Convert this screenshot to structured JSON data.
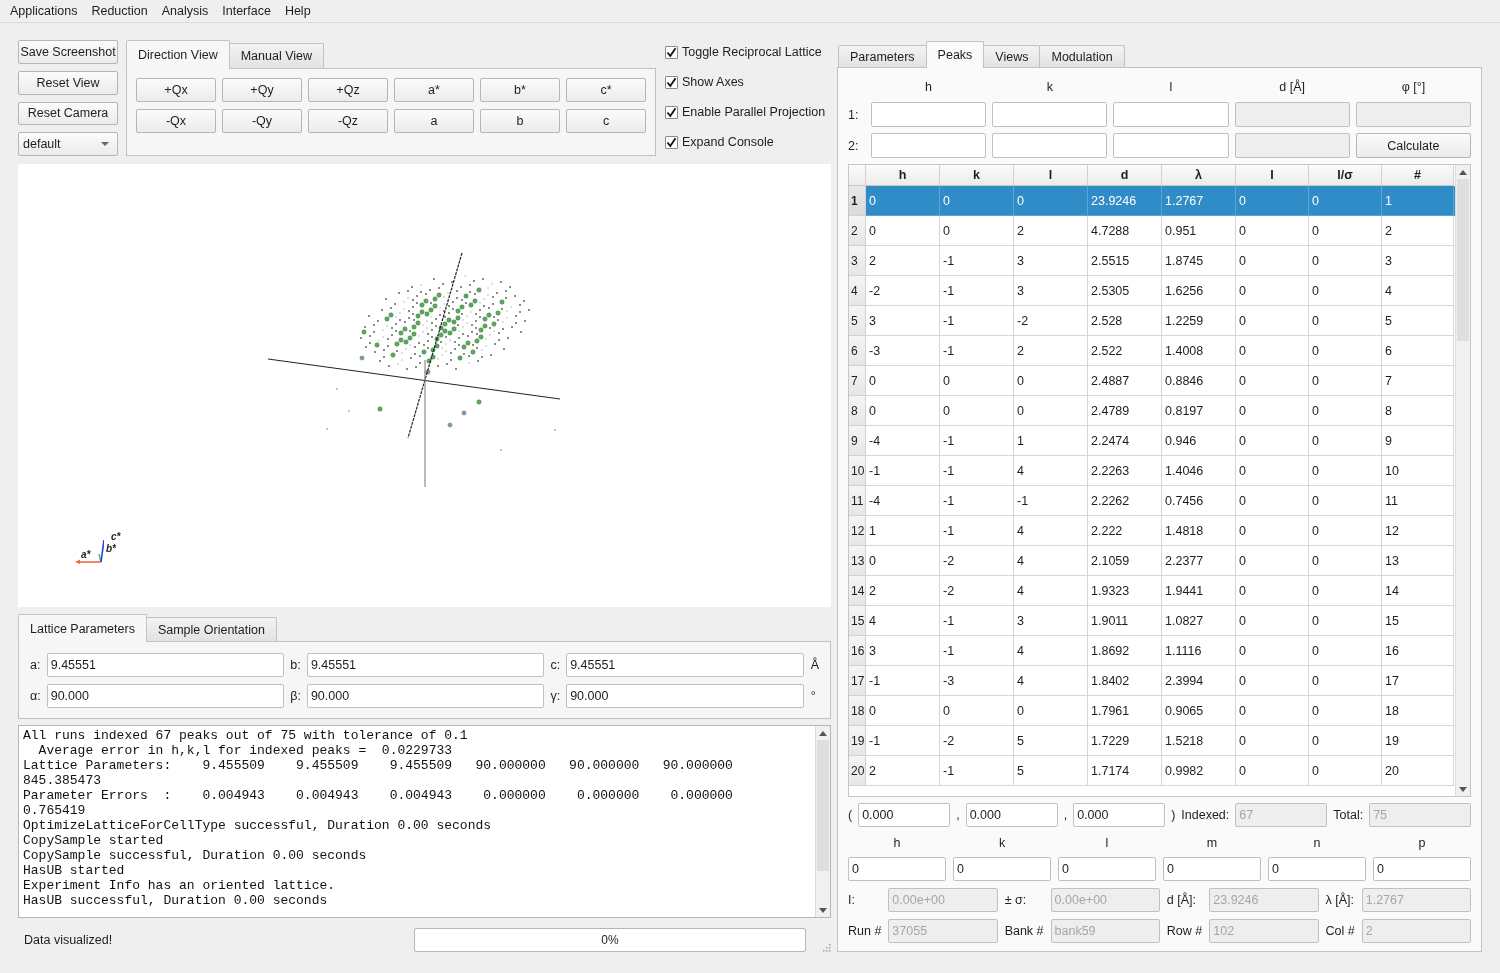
{
  "menu": [
    "Applications",
    "Reduction",
    "Analysis",
    "Interface",
    "Help"
  ],
  "view_buttons": [
    "Save Screenshot",
    "Reset View",
    "Reset Camera"
  ],
  "preset_dropdown": {
    "value": "default"
  },
  "direction_tabs": [
    {
      "label": "Direction View",
      "selected": true
    },
    {
      "label": "Manual View",
      "selected": false
    }
  ],
  "direction_buttons": [
    "+Qx",
    "+Qy",
    "+Qz",
    "a*",
    "b*",
    "c*",
    "-Qx",
    "-Qy",
    "-Qz",
    "a",
    "b",
    "c"
  ],
  "checkboxes": [
    {
      "label": "Toggle Reciprocal Lattice",
      "checked": true
    },
    {
      "label": "Show Axes",
      "checked": true
    },
    {
      "label": "Enable Parallel Projection",
      "checked": true
    },
    {
      "label": "Expand Console",
      "checked": true
    }
  ],
  "viewport": {
    "axis_labels": [
      "a*",
      "b*",
      "c*"
    ]
  },
  "lattice_tabs": [
    {
      "label": "Lattice Parameters",
      "selected": true
    },
    {
      "label": "Sample Orientation",
      "selected": false
    }
  ],
  "lattice_rows": [
    {
      "fields": [
        {
          "label": "a:",
          "value": "9.45551"
        },
        {
          "label": "b:",
          "value": "9.45551"
        },
        {
          "label": "c:",
          "value": "9.45551"
        }
      ],
      "unit": "Å"
    },
    {
      "fields": [
        {
          "label": "α:",
          "value": "90.000"
        },
        {
          "label": "β:",
          "value": "90.000"
        },
        {
          "label": "γ:",
          "value": "90.000"
        }
      ],
      "unit": "°"
    }
  ],
  "console": {
    "lines": [
      "All runs indexed 67 peaks out of 75 with tolerance of 0.1",
      "  Average error in h,k,l for indexed peaks =  0.0229733",
      "Lattice Parameters:    9.455509    9.455509    9.455509   90.000000   90.000000   90.000000",
      "845.385473",
      "Parameter Errors  :    0.004943    0.004943    0.004943    0.000000    0.000000    0.000000",
      "0.765419",
      "OptimizeLatticeForCellType successful, Duration 0.00 seconds",
      "CopySample started",
      "CopySample successful, Duration 0.00 seconds",
      "HasUB started",
      "Experiment Info has an oriented lattice.",
      "HasUB successful, Duration 0.00 seconds"
    ]
  },
  "status": {
    "message": "Data visualized!",
    "progress": {
      "level": 0,
      "reading": "0%"
    }
  },
  "right_tabs": [
    {
      "label": "Parameters",
      "selected": false
    },
    {
      "label": "Peaks",
      "selected": true
    },
    {
      "label": "Views",
      "selected": false
    },
    {
      "label": "Modulation",
      "selected": false
    }
  ],
  "angle_calc": {
    "headers": [
      "h",
      "k",
      "l",
      "d [Å]",
      "φ [°]"
    ],
    "rows": [
      {
        "label": "1:",
        "cells": [
          {
            "kind": "field",
            "disabled": false
          },
          {
            "kind": "field",
            "disabled": false
          },
          {
            "kind": "field",
            "disabled": false
          },
          {
            "kind": "field",
            "disabled": true
          },
          {
            "kind": "field",
            "disabled": true
          }
        ]
      },
      {
        "label": "2:",
        "cells": [
          {
            "kind": "field",
            "disabled": false
          },
          {
            "kind": "field",
            "disabled": false
          },
          {
            "kind": "field",
            "disabled": false
          },
          {
            "kind": "field",
            "disabled": true
          },
          {
            "kind": "button",
            "label": "Calculate"
          }
        ]
      }
    ]
  },
  "peaks_table": {
    "columns": [
      "h",
      "k",
      "l",
      "d",
      "λ",
      "I",
      "I/σ",
      "#"
    ],
    "rows": [
      {
        "label": "1",
        "selected": true,
        "cells": [
          "0",
          "0",
          "0",
          "23.9246",
          "1.2767",
          "0",
          "0",
          "1"
        ]
      },
      {
        "label": "2",
        "selected": false,
        "cells": [
          "0",
          "0",
          "2",
          "4.7288",
          "0.951",
          "0",
          "0",
          "2"
        ]
      },
      {
        "label": "3",
        "selected": false,
        "cells": [
          "2",
          "-1",
          "3",
          "2.5515",
          "1.8745",
          "0",
          "0",
          "3"
        ]
      },
      {
        "label": "4",
        "selected": false,
        "cells": [
          "-2",
          "-1",
          "3",
          "2.5305",
          "1.6256",
          "0",
          "0",
          "4"
        ]
      },
      {
        "label": "5",
        "selected": false,
        "cells": [
          "3",
          "-1",
          "-2",
          "2.528",
          "1.2259",
          "0",
          "0",
          "5"
        ]
      },
      {
        "label": "6",
        "selected": false,
        "cells": [
          "-3",
          "-1",
          "2",
          "2.522",
          "1.4008",
          "0",
          "0",
          "6"
        ]
      },
      {
        "label": "7",
        "selected": false,
        "cells": [
          "0",
          "0",
          "0",
          "2.4887",
          "0.8846",
          "0",
          "0",
          "7"
        ]
      },
      {
        "label": "8",
        "selected": false,
        "cells": [
          "0",
          "0",
          "0",
          "2.4789",
          "0.8197",
          "0",
          "0",
          "8"
        ]
      },
      {
        "label": "9",
        "selected": false,
        "cells": [
          "-4",
          "-1",
          "1",
          "2.2474",
          "0.946",
          "0",
          "0",
          "9"
        ]
      },
      {
        "label": "10",
        "selected": false,
        "cells": [
          "-1",
          "-1",
          "4",
          "2.2263",
          "1.4046",
          "0",
          "0",
          "10"
        ]
      },
      {
        "label": "11",
        "selected": false,
        "cells": [
          "-4",
          "-1",
          "-1",
          "2.2262",
          "0.7456",
          "0",
          "0",
          "11"
        ]
      },
      {
        "label": "12",
        "selected": false,
        "cells": [
          "1",
          "-1",
          "4",
          "2.222",
          "1.4818",
          "0",
          "0",
          "12"
        ]
      },
      {
        "label": "13",
        "selected": false,
        "cells": [
          "0",
          "-2",
          "4",
          "2.1059",
          "2.2377",
          "0",
          "0",
          "13"
        ]
      },
      {
        "label": "14",
        "selected": false,
        "cells": [
          "2",
          "-2",
          "4",
          "1.9323",
          "1.9441",
          "0",
          "0",
          "14"
        ]
      },
      {
        "label": "15",
        "selected": false,
        "cells": [
          "4",
          "-1",
          "3",
          "1.9011",
          "1.0827",
          "0",
          "0",
          "15"
        ]
      },
      {
        "label": "16",
        "selected": false,
        "cells": [
          "3",
          "-1",
          "4",
          "1.8692",
          "1.1116",
          "0",
          "0",
          "16"
        ]
      },
      {
        "label": "17",
        "selected": false,
        "cells": [
          "-1",
          "-3",
          "4",
          "1.8402",
          "2.3994",
          "0",
          "0",
          "17"
        ]
      },
      {
        "label": "18",
        "selected": false,
        "cells": [
          "0",
          "0",
          "0",
          "1.7961",
          "0.9065",
          "0",
          "0",
          "18"
        ]
      },
      {
        "label": "19",
        "selected": false,
        "cells": [
          "-1",
          "-2",
          "5",
          "1.7229",
          "1.5218",
          "0",
          "0",
          "19"
        ]
      },
      {
        "label": "20",
        "selected": false,
        "cells": [
          "2",
          "-1",
          "5",
          "1.7174",
          "0.9982",
          "0",
          "0",
          "20"
        ]
      }
    ]
  },
  "q_vector": {
    "open": "(",
    "values": [
      "0.000",
      "0.000",
      "0.000"
    ],
    "separators": [
      ",",
      ","
    ],
    "close": ")"
  },
  "counts": [
    {
      "label": "Indexed:",
      "value": "67",
      "disabled": true
    },
    {
      "label": "Total:",
      "value": "75",
      "disabled": true
    }
  ],
  "hklmnp": [
    {
      "label": "h",
      "value": "0"
    },
    {
      "label": "k",
      "value": "0"
    },
    {
      "label": "l",
      "value": "0"
    },
    {
      "label": "m",
      "value": "0"
    },
    {
      "label": "n",
      "value": "0"
    },
    {
      "label": "p",
      "value": "0"
    }
  ],
  "peak_info": [
    {
      "label": "I:",
      "value": "0.00e+00",
      "disabled": true
    },
    {
      "label": "± σ:",
      "value": "0.00e+00",
      "disabled": true
    },
    {
      "label": "d [Å]:",
      "value": "23.9246",
      "disabled": true
    },
    {
      "label": "λ [Å]:",
      "value": "1.2767",
      "disabled": true
    },
    {
      "label": "Run #",
      "value": "37055",
      "disabled": true
    },
    {
      "label": "Bank #",
      "value": "bank59",
      "disabled": true
    },
    {
      "label": "Row #",
      "value": "102",
      "disabled": true
    },
    {
      "label": "Col #",
      "value": "2",
      "disabled": true
    }
  ]
}
